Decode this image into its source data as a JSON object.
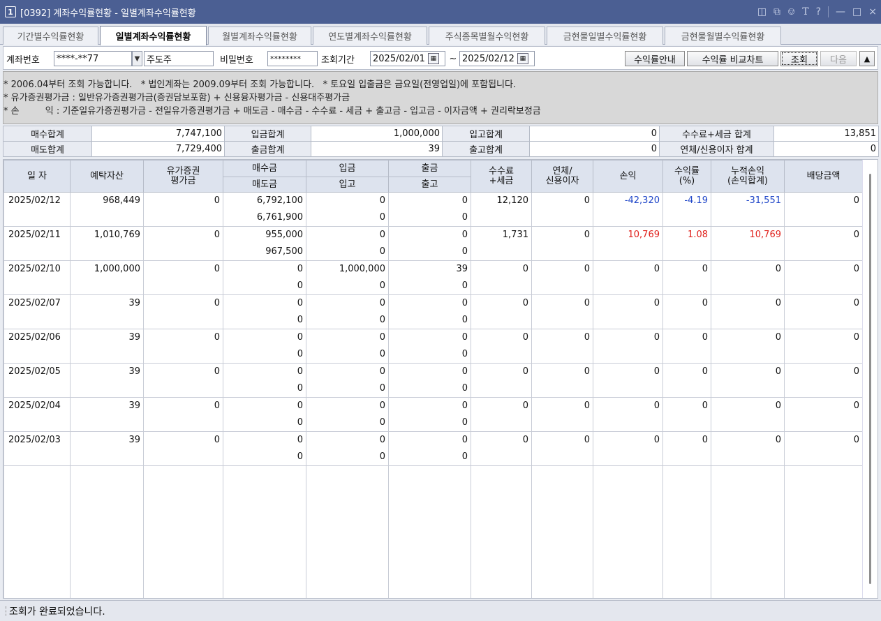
{
  "window": {
    "number": "1",
    "title": "[0392] 계좌수익률현황 - 일별계좌수익률현황"
  },
  "tabs": [
    "기간별수익률현황",
    "일별계좌수익률현황",
    "월별계좌수익률현황",
    "연도별계좌수익률현황",
    "주식종목별월수익현황",
    "금현물일별수익률현황",
    "금현물월별수익률현황"
  ],
  "query": {
    "account_label": "계좌번호",
    "account_value": "****-**77",
    "account_name": "주도주",
    "password_label": "비밀번호",
    "password_value": "********",
    "period_label": "조회기간",
    "start_date": "2025/02/01",
    "period_sep": "~",
    "end_date": "2025/02/12",
    "btn_guide": "수익률안내",
    "btn_compare": "수익률 비교차트",
    "btn_search": "조회",
    "btn_next": "다음"
  },
  "notice": [
    "* 2006.04부터 조회 가능합니다.   * 법인계좌는 2009.09부터 조회 가능합니다.   * 토요일 입출금은 금요일(전영업일)에 포함됩니다.",
    "* 유가증권평가금 : 일반유가증권평가금(증권담보포함) + 신용융자평가금 - 신용대주평가금",
    "* 손         익 : 기준일유가증권평가금 - 전일유가증권평가금 + 매도금 - 매수금 - 수수료 - 세금 + 출고금 - 입고금 - 이자금액 + 권리락보정금"
  ],
  "summary": {
    "buy_total_label": "매수합계",
    "buy_total": "7,747,100",
    "deposit_total_label": "입금합계",
    "deposit_total": "1,000,000",
    "in_total_label": "입고합계",
    "in_total": "0",
    "fee_tax_label": "수수료+세금 합계",
    "fee_tax": "13,851",
    "sell_total_label": "매도합계",
    "sell_total": "7,729,400",
    "withdraw_total_label": "출금합계",
    "withdraw_total": "39",
    "out_total_label": "출고합계",
    "out_total": "0",
    "interest_label": "연체/신용이자 합계",
    "interest": "0"
  },
  "grid": {
    "headers": {
      "date": "일 자",
      "deposit_asset": "예탁자산",
      "sec_eval_1": "유가증권",
      "sec_eval_2": "평가금",
      "buy": "매수금",
      "sell": "매도금",
      "deposit": "입금",
      "in": "입고",
      "withdraw": "출금",
      "out": "출고",
      "fee_1": "수수료",
      "fee_2": "+세금",
      "overdue_1": "연체/",
      "overdue_2": "신용이자",
      "pnl": "손익",
      "rate_1": "수익률",
      "rate_2": "(%)",
      "cum_1": "누적손익",
      "cum_2": "(손익합계)",
      "dividend": "배당금액"
    },
    "rows": [
      {
        "date": "2025/02/12",
        "asset": "968,449",
        "eval": "0",
        "buy": "6,792,100",
        "sell": "6,761,900",
        "deposit": "0",
        "in": "0",
        "withdraw": "0",
        "out": "0",
        "fee": "12,120",
        "overdue": "0",
        "pnl": "-42,320",
        "rate": "-4.19",
        "cum": "-31,551",
        "dividend": "0",
        "sign": "neg"
      },
      {
        "date": "2025/02/11",
        "asset": "1,010,769",
        "eval": "0",
        "buy": "955,000",
        "sell": "967,500",
        "deposit": "0",
        "in": "0",
        "withdraw": "0",
        "out": "0",
        "fee": "1,731",
        "overdue": "0",
        "pnl": "10,769",
        "rate": "1.08",
        "cum": "10,769",
        "dividend": "0",
        "sign": "pos"
      },
      {
        "date": "2025/02/10",
        "asset": "1,000,000",
        "eval": "0",
        "buy": "0",
        "sell": "0",
        "deposit": "1,000,000",
        "in": "0",
        "withdraw": "39",
        "out": "0",
        "fee": "0",
        "overdue": "0",
        "pnl": "0",
        "rate": "0",
        "cum": "0",
        "dividend": "0",
        "sign": ""
      },
      {
        "date": "2025/02/07",
        "asset": "39",
        "eval": "0",
        "buy": "0",
        "sell": "0",
        "deposit": "0",
        "in": "0",
        "withdraw": "0",
        "out": "0",
        "fee": "0",
        "overdue": "0",
        "pnl": "0",
        "rate": "0",
        "cum": "0",
        "dividend": "0",
        "sign": ""
      },
      {
        "date": "2025/02/06",
        "asset": "39",
        "eval": "0",
        "buy": "0",
        "sell": "0",
        "deposit": "0",
        "in": "0",
        "withdraw": "0",
        "out": "0",
        "fee": "0",
        "overdue": "0",
        "pnl": "0",
        "rate": "0",
        "cum": "0",
        "dividend": "0",
        "sign": ""
      },
      {
        "date": "2025/02/05",
        "asset": "39",
        "eval": "0",
        "buy": "0",
        "sell": "0",
        "deposit": "0",
        "in": "0",
        "withdraw": "0",
        "out": "0",
        "fee": "0",
        "overdue": "0",
        "pnl": "0",
        "rate": "0",
        "cum": "0",
        "dividend": "0",
        "sign": ""
      },
      {
        "date": "2025/02/04",
        "asset": "39",
        "eval": "0",
        "buy": "0",
        "sell": "0",
        "deposit": "0",
        "in": "0",
        "withdraw": "0",
        "out": "0",
        "fee": "0",
        "overdue": "0",
        "pnl": "0",
        "rate": "0",
        "cum": "0",
        "dividend": "0",
        "sign": ""
      },
      {
        "date": "2025/02/03",
        "asset": "39",
        "eval": "0",
        "buy": "0",
        "sell": "0",
        "deposit": "0",
        "in": "0",
        "withdraw": "0",
        "out": "0",
        "fee": "0",
        "overdue": "0",
        "pnl": "0",
        "rate": "0",
        "cum": "0",
        "dividend": "0",
        "sign": ""
      }
    ]
  },
  "status": "조회가 완료되었습니다.",
  "colors": {
    "title_bg": "#4b5f93",
    "negative": "#1f46c8",
    "positive": "#e0201b",
    "header_bg": "#dde3ee"
  }
}
